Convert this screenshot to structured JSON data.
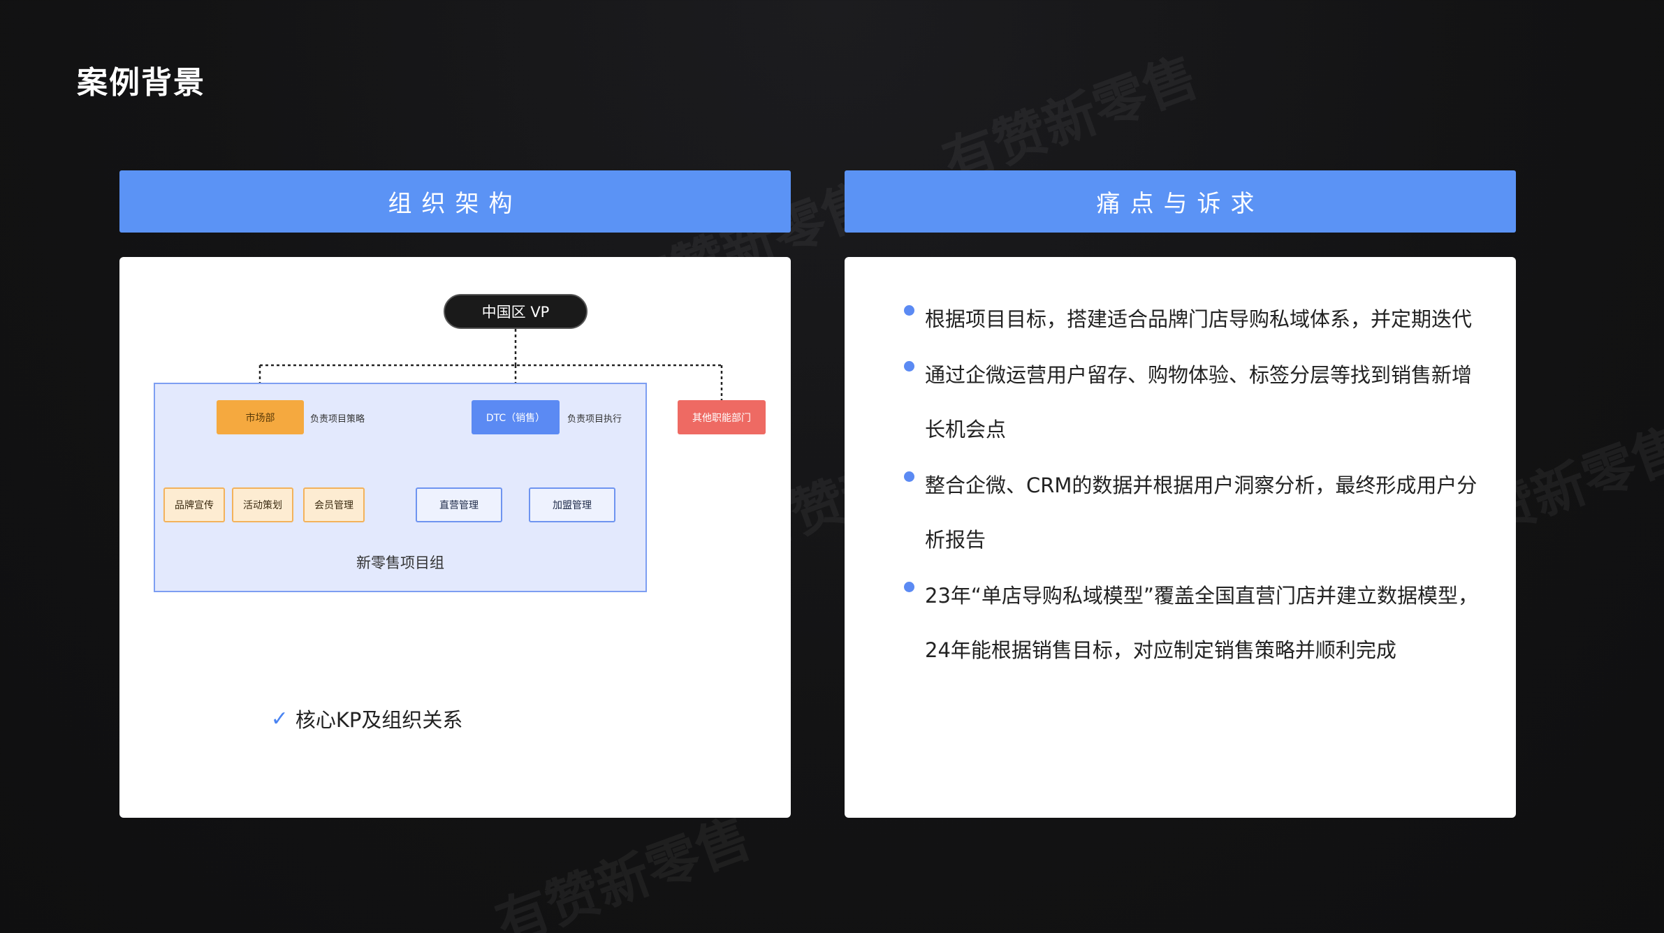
{
  "page": {
    "title": "案例背景"
  },
  "watermarks": [
    "有赞新零售",
    "有赞新零售",
    "有赞新零售",
    "有赞新零售",
    "有赞新零售"
  ],
  "left_panel": {
    "header": "组织架构",
    "org_chart": {
      "vp": "中国区 VP",
      "group_label": "新零售项目组",
      "marketing": {
        "label": "市场部",
        "note": "负责项目策略"
      },
      "marketing_children": [
        "品牌宣传",
        "活动策划",
        "会员管理"
      ],
      "dtc": {
        "label": "DTC（销售）",
        "note": "负责项目执行"
      },
      "dtc_children": [
        "直营管理",
        "加盟管理"
      ],
      "other": {
        "label": "其他职能部门"
      }
    },
    "caption": "核心KP及组织关系"
  },
  "right_panel": {
    "header": "痛点与诉求",
    "bullets": [
      "根据项目目标，搭建适合品牌门店导购私域体系，并定期迭代",
      "通过企微运营用户留存、购物体验、标签分层等找到销售新增长机会点",
      "整合企微、CRM的数据并根据用户洞察分析，最终形成用户分析报告",
      "23年“单店导购私域模型”覆盖全国直营门店并建立数据模型，24年能根据销售目标，对应制定销售策略并顺利完成"
    ]
  },
  "colors": {
    "accent_blue": "#5b93f5",
    "orange": "#f5a93f",
    "red": "#ee6a63",
    "background": "#141415"
  },
  "icons": [
    "check-icon",
    "bullet-dot-icon"
  ]
}
